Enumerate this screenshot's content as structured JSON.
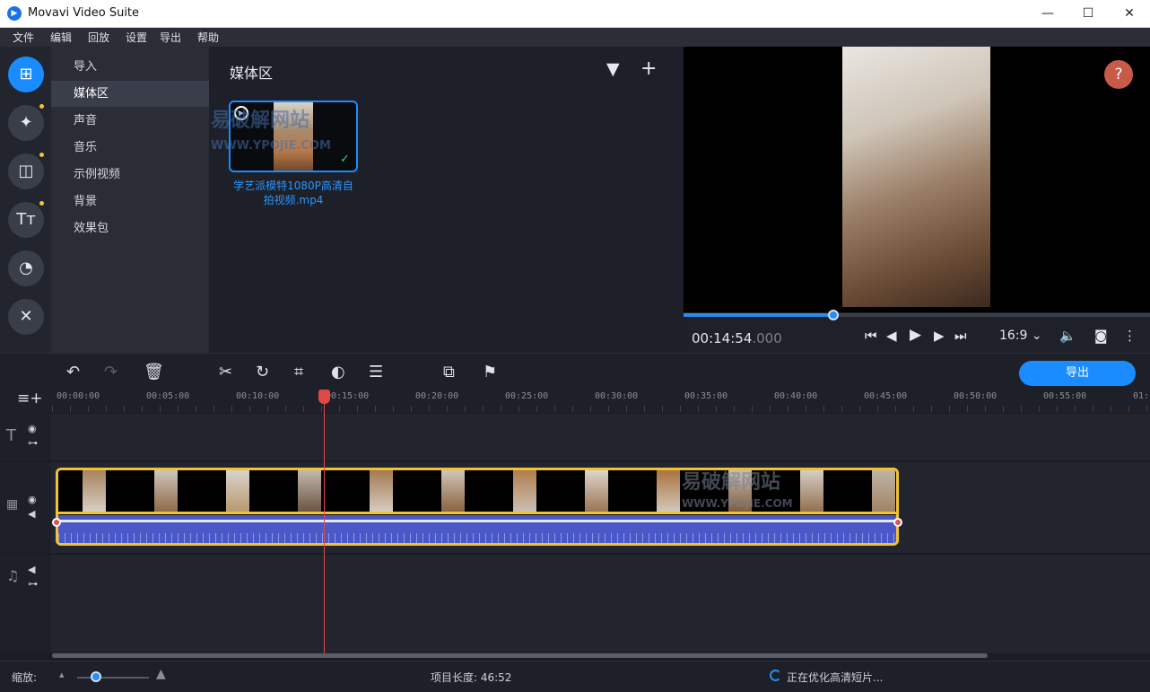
{
  "window": {
    "title": "Movavi Video Suite",
    "minimize": "—",
    "maximize": "☐",
    "close": "✕"
  },
  "menu": [
    "文件",
    "编辑",
    "回放",
    "设置",
    "导出",
    "帮助"
  ],
  "nav": {
    "items": [
      "导入",
      "媒体区",
      "声音",
      "音乐",
      "示例视频",
      "背景",
      "效果包"
    ],
    "active_index": 1
  },
  "media": {
    "title": "媒体区",
    "clip_caption_line1": "学艺派模特1080P高清自",
    "clip_caption_line2": "拍视频.mp4",
    "watermark_line1": "易破解网站",
    "watermark_line2": "WWW.YPOJIE.COM"
  },
  "preview": {
    "timecode_main": "00:14:54",
    "timecode_ms": ".000",
    "aspect_ratio": "16:9",
    "help_label": "?",
    "seek_fraction": 0.322
  },
  "toolbar": {
    "export_label": "导出"
  },
  "ruler": {
    "ticks": [
      "00:00:00",
      "00:05:00",
      "00:10:00",
      "00:15:00",
      "00:20:00",
      "00:25:00",
      "00:30:00",
      "00:35:00",
      "00:40:00",
      "00:45:00",
      "00:50:00",
      "00:55:00",
      "01:"
    ]
  },
  "timeline_watermark": {
    "line1": "易破解网站",
    "line2": "WWW.YPOJIE.COM"
  },
  "status": {
    "zoom_label": "缩放:",
    "project_length": "项目长度:  46:52",
    "optimizing": "正在优化高清短片..."
  },
  "colors": {
    "accent": "#1a8cff",
    "clip_border": "#f2c230",
    "playhead": "#e04848",
    "help": "#c85a48"
  }
}
